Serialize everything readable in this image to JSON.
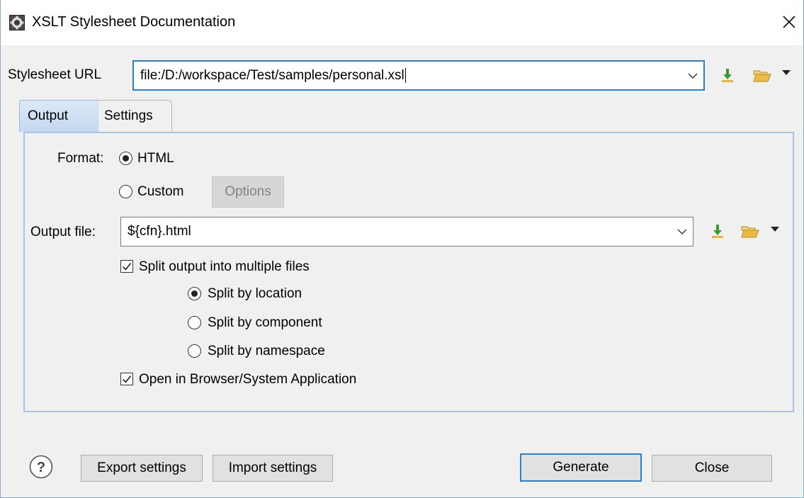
{
  "window": {
    "title": "XSLT Stylesheet Documentation",
    "app_icon": "gear-icon",
    "close_icon": "close-icon"
  },
  "stylesheet": {
    "label": "Stylesheet URL",
    "value": "file:/D:/workspace/Test/samples/personal.xsl",
    "insert_icon": "insert-editor-variables-icon",
    "browse_icon": "folder-open-icon",
    "browse_menu_icon": "dropdown-arrow-icon"
  },
  "tabs": [
    {
      "label": "Output",
      "selected": true
    },
    {
      "label": "Settings",
      "selected": false
    }
  ],
  "output": {
    "format_label": "Format:",
    "format_options": [
      {
        "label": "HTML",
        "selected": true
      },
      {
        "label": "Custom",
        "selected": false
      }
    ],
    "options_button": "Options",
    "output_file_label": "Output file:",
    "output_file_value": "${cfn}.html",
    "split_checkbox": {
      "label": "Split output into multiple files",
      "checked": true
    },
    "split_options": [
      {
        "label": "Split by location",
        "selected": true
      },
      {
        "label": "Split by component",
        "selected": false
      },
      {
        "label": "Split by namespace",
        "selected": false
      }
    ],
    "open_browser_checkbox": {
      "label": "Open in Browser/System Application",
      "checked": true
    }
  },
  "footer": {
    "help_icon": "help-icon",
    "export_button": "Export settings",
    "import_button": "Import settings",
    "generate_button": "Generate",
    "close_button": "Close"
  },
  "colors": {
    "accent": "#2a7fd4",
    "tab_selected": "#c9dbef",
    "panel_border": "#a9c4e1",
    "insert_icon_green": "#3a9a2c",
    "folder_yellow": "#e9b53a"
  }
}
